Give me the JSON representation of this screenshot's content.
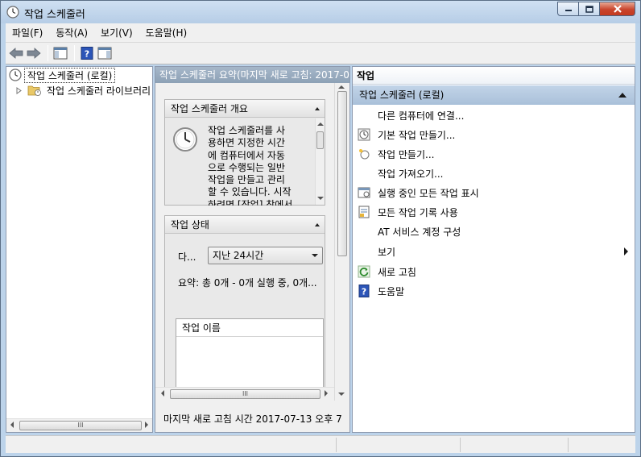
{
  "window": {
    "title": "작업 스케줄러",
    "icon": "clock-icon",
    "buttons": [
      "minimize-icon",
      "maximize-icon",
      "close-icon"
    ]
  },
  "menu": {
    "items": [
      "파일(F)",
      "동작(A)",
      "보기(V)",
      "도움말(H)"
    ]
  },
  "toolbar": {
    "buttons": [
      "back-arrow-icon",
      "forward-arrow-icon",
      "show-hide-console-tree-icon",
      "help-icon",
      "show-hide-action-pane-icon"
    ]
  },
  "tree": {
    "root": "작업 스케줄러 (로컬)",
    "child": "작업 스케줄러 라이브러리"
  },
  "middle": {
    "header": "작업 스케줄러 요약(마지막 새로 고침: 2017-0",
    "overview": {
      "title": "작업 스케줄러 개요",
      "lines": [
        "작업 스케줄러를 사",
        "용하면 지정한 시간",
        "에 컴퓨터에서 자동",
        "으로 수행되는 일반",
        "작업을 만들고 관리",
        "할 수 있습니다. 시작",
        "하려면 [작업] 창에서"
      ]
    },
    "status": {
      "title": "작업 상태",
      "filter_label": "다...",
      "filter_value": "지난 24시간",
      "summary": "요약: 총 0개 - 0개 실행 중, 0개...",
      "column_header": "작업 이름"
    },
    "footer": "마지막 새로 고침 시간 2017-07-13 오후 7"
  },
  "actions": {
    "header": "작업",
    "group": "작업 스케줄러 (로컬)",
    "items": [
      {
        "label": "다른 컴퓨터에 연결...",
        "icon": ""
      },
      {
        "label": "기본 작업 만들기...",
        "icon": "basic-task-wizard-icon"
      },
      {
        "label": "작업 만들기...",
        "icon": "create-task-icon"
      },
      {
        "label": "작업 가져오기...",
        "icon": ""
      },
      {
        "label": "실행 중인 모든 작업 표시",
        "icon": "running-tasks-icon"
      },
      {
        "label": "모든 작업 기록 사용",
        "icon": "task-history-icon"
      },
      {
        "label": "AT 서비스 계정 구성",
        "icon": ""
      },
      {
        "label": "보기",
        "icon": "",
        "submenu": true
      },
      {
        "label": "새로 고침",
        "icon": "refresh-icon"
      },
      {
        "label": "도움말",
        "icon": "help-icon"
      }
    ]
  },
  "colors": {
    "title_bar": "#bcd3ea",
    "action_group": "#b4c8df",
    "mid_header": "#9aaec2",
    "close_button": "#c9452d"
  }
}
